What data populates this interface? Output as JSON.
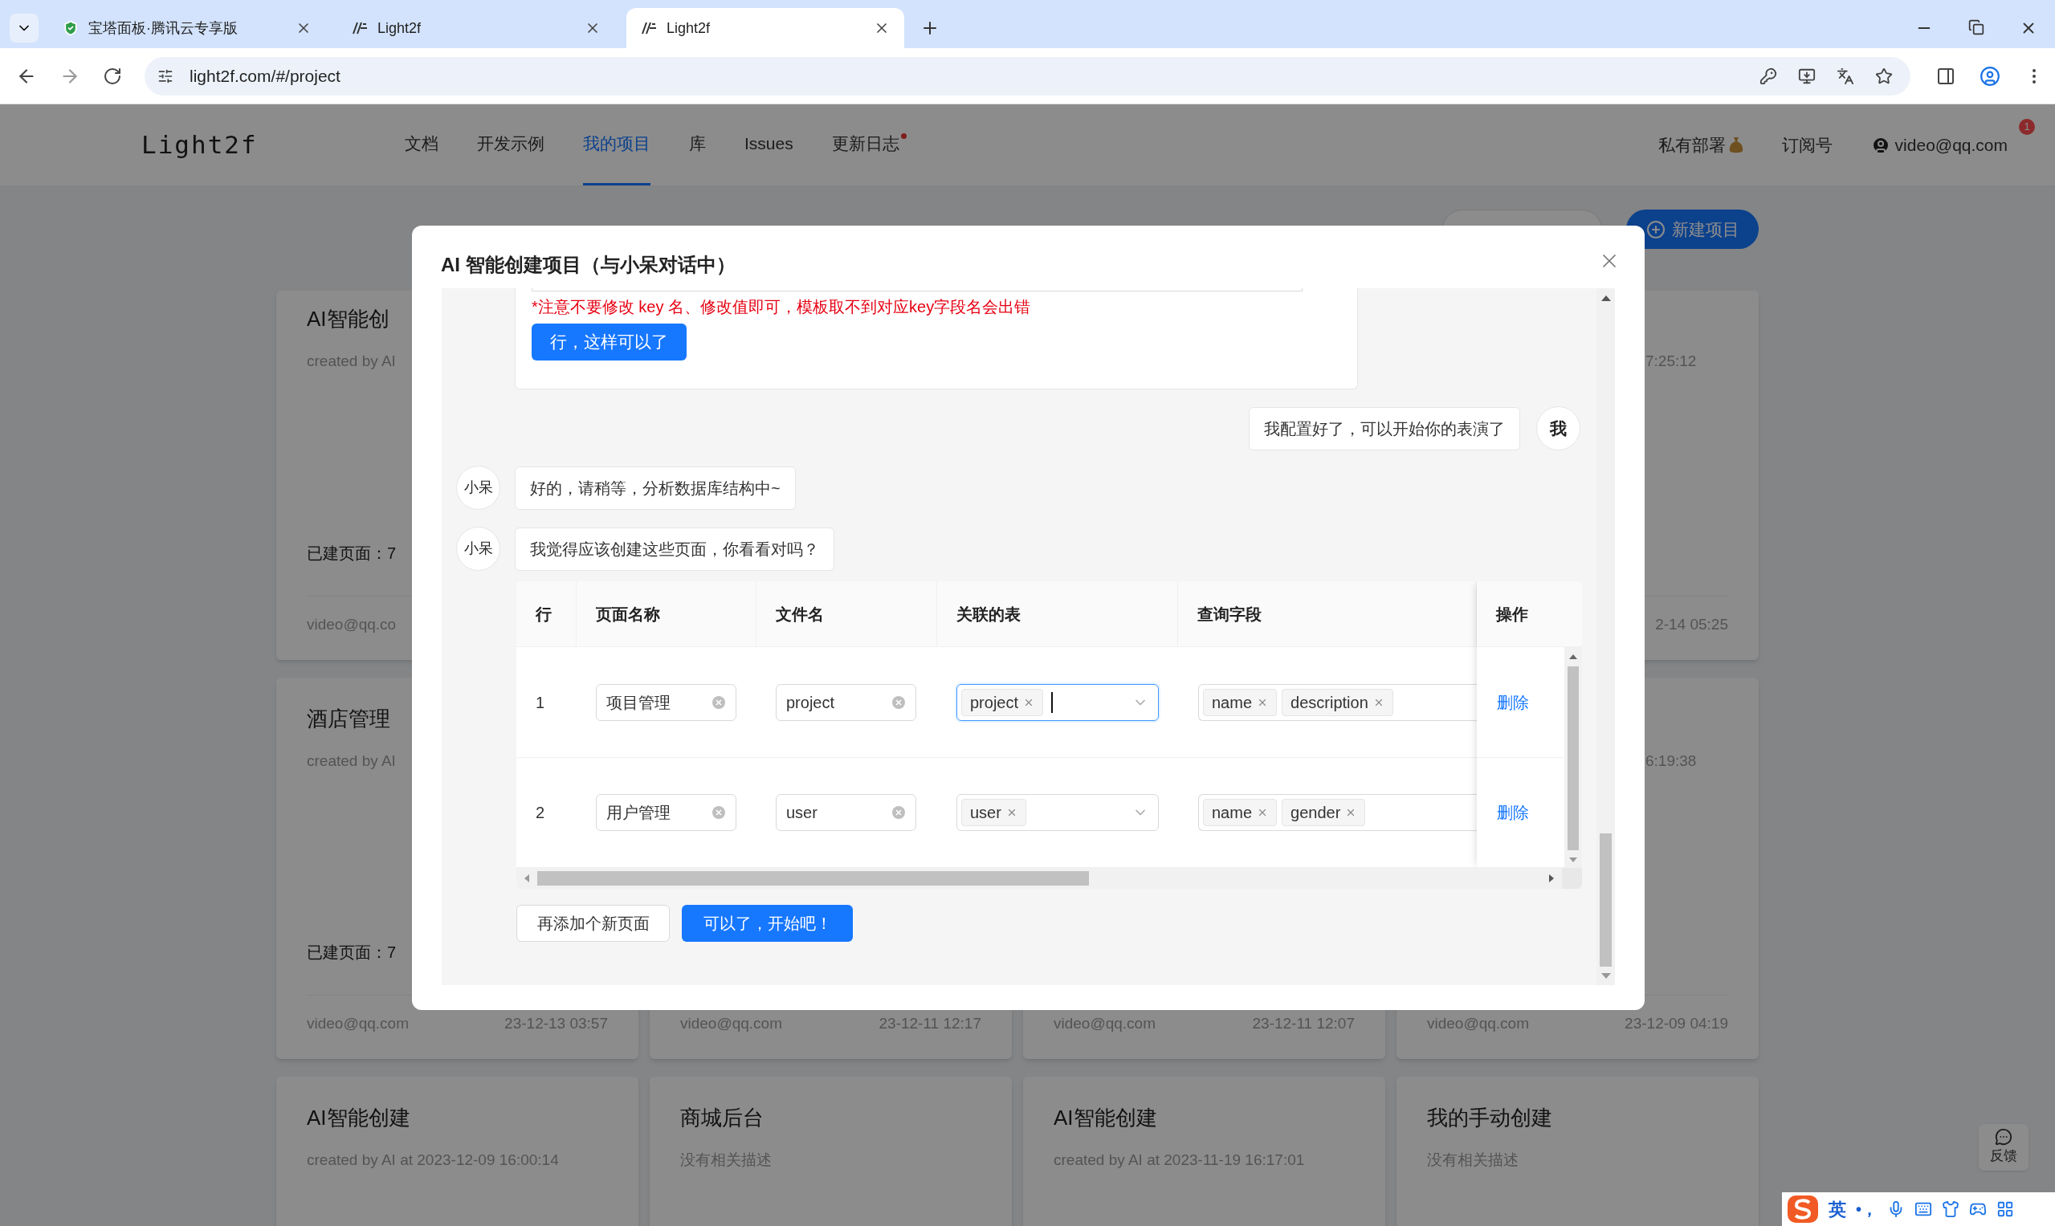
{
  "browser": {
    "tabs": [
      {
        "title": "宝塔面板·腾讯云专享版",
        "selected": false
      },
      {
        "title": "Light2f",
        "selected": false
      },
      {
        "title": "Light2f",
        "selected": true
      }
    ],
    "url": "light2f.com/#/project"
  },
  "site_header": {
    "logo": "Light2f",
    "nav": [
      {
        "label": "文档",
        "selected": false,
        "dot": false
      },
      {
        "label": "开发示例",
        "selected": false,
        "dot": false
      },
      {
        "label": "我的项目",
        "selected": true,
        "dot": false
      },
      {
        "label": "库",
        "selected": false,
        "dot": false
      },
      {
        "label": "Issues",
        "selected": false,
        "dot": false
      },
      {
        "label": "更新日志",
        "selected": false,
        "dot": true
      }
    ],
    "private_deploy": "私有部署",
    "subscribe": "订阅号",
    "user_email": "video@qq.com",
    "notification_count": "1"
  },
  "toolbar": {
    "new_project_button": "新建项目"
  },
  "card_rows": [
    [
      {
        "title": "AI智能创",
        "subtitle": "created by AI",
        "pages": "已建页面：7",
        "email": "video@qq.co"
      },
      {},
      {},
      {
        "subtitle": "7:25:12",
        "time": "2-14 05:25"
      }
    ],
    [
      {
        "title": "酒店管理",
        "subtitle": "created by AI",
        "pages": "已建页面：7",
        "email": "video@qq.com",
        "time": "23-12-13 03:57"
      },
      {
        "email": "video@qq.com",
        "time": "23-12-11 12:17"
      },
      {
        "email": "video@qq.com",
        "time": "23-12-11 12:07"
      },
      {
        "subtitle": "6:19:38",
        "email": "video@qq.com",
        "time": "23-12-09 04:19"
      }
    ],
    [
      {
        "title": "AI智能创建",
        "subtitle": "created by AI at 2023-12-09 16:00:14"
      },
      {
        "title": "商城后台",
        "subtitle": "没有相关描述"
      },
      {
        "title": "AI智能创建",
        "subtitle": "created by AI at 2023-11-19 16:17:01"
      },
      {
        "title": "我的手动创建",
        "subtitle": "没有相关描述"
      }
    ]
  ],
  "feedback": "反馈",
  "modal": {
    "title": "AI 智能创建项目（与小呆对话中）",
    "messages": [
      {
        "kind": "config_form",
        "warning": "*注意不要修改 key 名、修改值即可，模板取不到对应key字段名会出错",
        "button": "行，这样可以了"
      },
      {
        "kind": "user",
        "avatar": "我",
        "text": "我配置好了，可以开始你的表演了"
      },
      {
        "kind": "bot",
        "avatar": "小呆",
        "text": "好的，请稍等，分析数据库结构中~"
      },
      {
        "kind": "bot",
        "avatar": "小呆",
        "text": "我觉得应该创建这些页面，你看看对吗？"
      }
    ],
    "table": {
      "columns": [
        "行",
        "页面名称",
        "文件名",
        "关联的表",
        "查询字段",
        "操作"
      ],
      "rows": [
        {
          "index": "1",
          "page_name": "项目管理",
          "file_name": "project",
          "tables": [
            "project"
          ],
          "table_focused": true,
          "fields": [
            "name",
            "description"
          ],
          "action": "删除"
        },
        {
          "index": "2",
          "page_name": "用户管理",
          "file_name": "user",
          "tables": [
            "user"
          ],
          "table_focused": false,
          "fields": [
            "name",
            "gender"
          ],
          "action": "删除"
        }
      ]
    },
    "add_page_button": "再添加个新页面",
    "confirm_button": "可以了，开始吧！"
  },
  "ime_bar": {
    "mode": "英",
    "punctuation": "•，"
  }
}
